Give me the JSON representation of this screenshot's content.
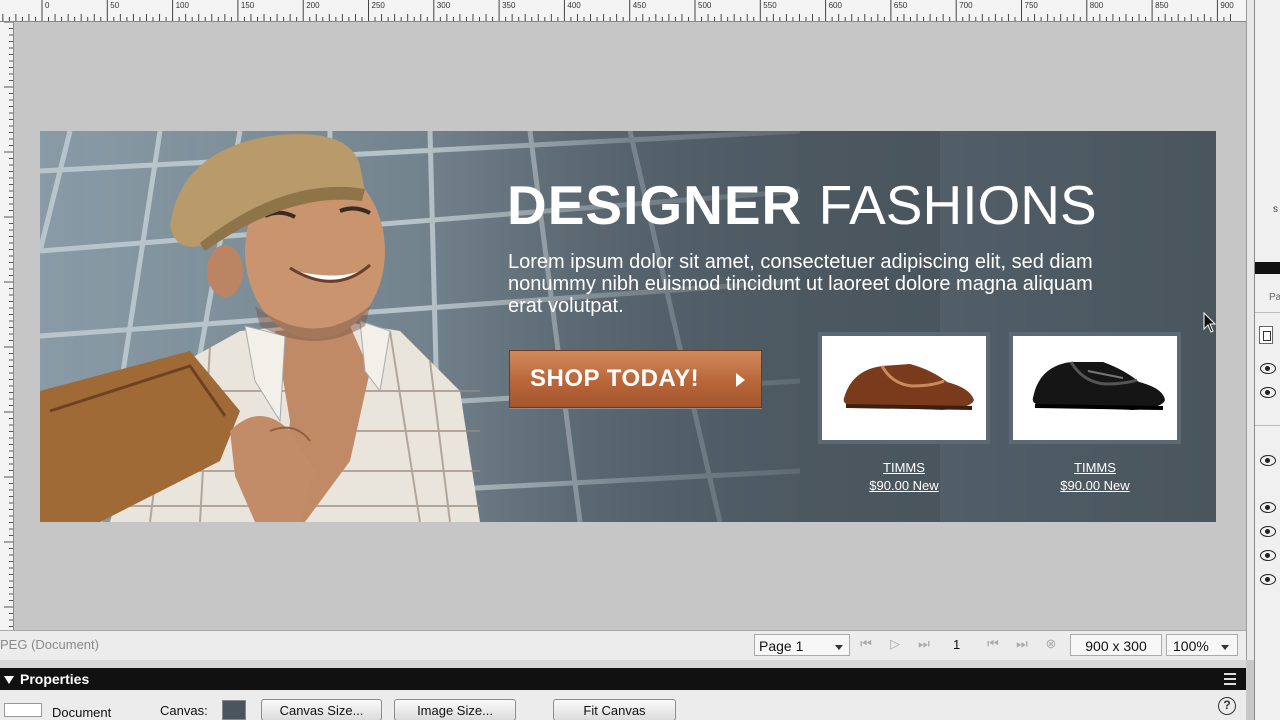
{
  "ruler": {
    "labels": [
      "0",
      "50",
      "100",
      "150",
      "200",
      "250",
      "300",
      "350",
      "400",
      "450",
      "500",
      "550",
      "600",
      "650",
      "700",
      "750",
      "800",
      "850",
      "900"
    ]
  },
  "banner": {
    "headline_bold": "DESIGNER",
    "headline_light": "FASHIONS",
    "copy": "Lorem ipsum dolor sit amet, consectetuer adipiscing elit, sed diam nonummy nibh euismod tincidunt ut laoreet dolore magna aliquam erat volutpat.",
    "cta": "SHOP TODAY!",
    "products": [
      {
        "brand": "TIMMS",
        "price": "$90.00 New",
        "shoe_color": "#7a3b1c"
      },
      {
        "brand": "TIMMS",
        "price": "$90.00 New",
        "shoe_color": "#151515"
      }
    ],
    "bg_color": "#4a555d",
    "cta_color": "#b9663a"
  },
  "status": {
    "document_type": "PEG (Document)",
    "page": "Page 1",
    "page_number": "1",
    "canvas_size": "900 x 300",
    "zoom": "100%"
  },
  "properties": {
    "title": "Properties",
    "selection": "Document",
    "canvas_label": "Canvas:",
    "canvas_color": "#4a555d",
    "buttons": [
      "Canvas Size...",
      "Image Size...",
      "Fit Canvas"
    ],
    "help": "?"
  },
  "right_panel": {
    "tab_label": "Pa",
    "partial_label": "s"
  }
}
